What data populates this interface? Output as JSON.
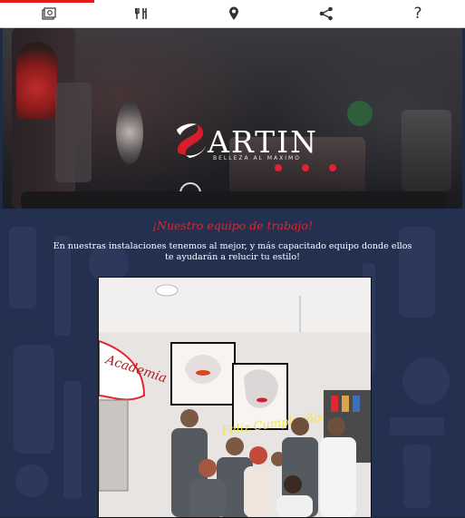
{
  "nav": {
    "items": [
      {
        "icon": "photo-gallery-icon"
      },
      {
        "icon": "salon-tools-icon"
      },
      {
        "icon": "location-pin-icon"
      },
      {
        "icon": "share-icon"
      },
      {
        "icon": "help-icon",
        "glyph": "?"
      }
    ],
    "accent_color": "#e11a1a"
  },
  "hero": {
    "logo_word": "ARTIN",
    "logo_tagline": "BELLEZA AL MAXIMO",
    "logo_colors": {
      "red": "#d81e2a",
      "white": "#ffffff"
    }
  },
  "team": {
    "title": "¡Nuestro equipo de trabajo!",
    "description": "En nuestras instalaciones tenemos al mejor, y más capacitado equipo donde ellos te ayudarán a relucir tu estilo!",
    "photo_sign_text": "Academia",
    "neon_text": "Feliz Cumpleaños"
  },
  "colors": {
    "title_red": "#e0262f",
    "section_bg": "#24304f"
  }
}
